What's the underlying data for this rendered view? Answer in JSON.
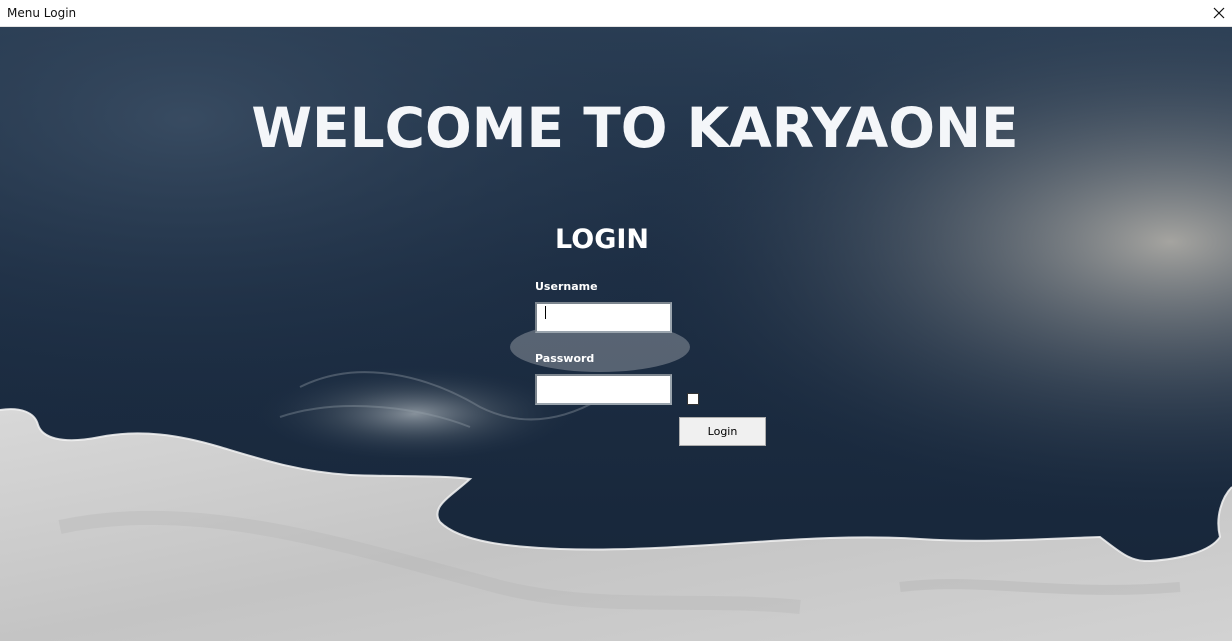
{
  "window": {
    "title": "Menu Login",
    "close_icon": "close-icon"
  },
  "main": {
    "welcome_heading": "WELCOME TO KARYAONE",
    "login_heading": "LOGIN",
    "username_label": "Username",
    "username_value": "",
    "password_label": "Password",
    "password_value": "",
    "show_password_checked": false,
    "login_button": "Login"
  },
  "colors": {
    "water_dark": "#1c2d42",
    "sand": "#c9c9c9",
    "heading_text": "#f4f6f9"
  }
}
